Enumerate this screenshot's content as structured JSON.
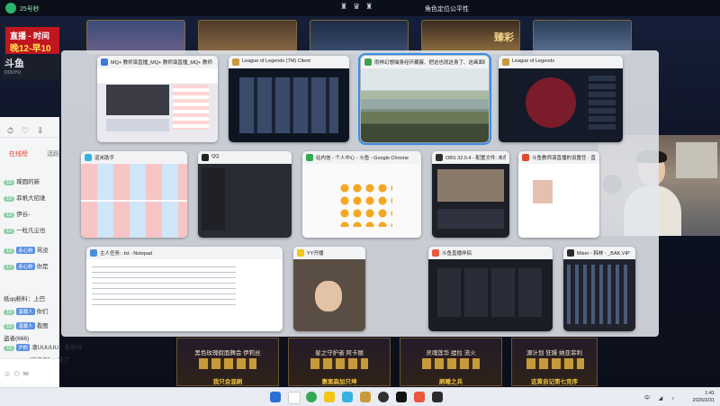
{
  "top_bar": {
    "app_name": "25号秒",
    "center_title": "角色定位公平性"
  },
  "stream": {
    "tag_line1": "直播 - 时间",
    "tag_line2": "晚12-早10",
    "logo_big": "斗鱼",
    "logo_small": "DOUYU",
    "hero_banner": "臻彩",
    "bottom_cards": [
      {
        "name": "黑色玫瑰假面舞会 伊莉丝",
        "sub": "我只会混刷"
      },
      {
        "name": "星之守护者 阿卡丽",
        "sub": "惠案森加只坤"
      },
      {
        "name": "灵魂莲华 缇拉 流火",
        "sub": "刷睡之兵"
      },
      {
        "name": "源计划 狂躁 纳亚菲利",
        "sub": "这黄自记第七竞序"
      }
    ]
  },
  "chat": {
    "tab_active": "在线榜",
    "tab_other": "活跃",
    "messages": [
      {
        "level": "15",
        "fan": "",
        "text": "璨圆的新"
      },
      {
        "level": "15",
        "fan": "",
        "text": "菲帆大招谁"
      },
      {
        "level": "13",
        "fan": "",
        "text": "伊谷-"
      },
      {
        "level": "12",
        "fan": "",
        "text": "一粒凡尘也"
      },
      {
        "level": "13",
        "fan": "赤心粉",
        "text": "骂没"
      },
      {
        "level": "17",
        "fan": "赤心粉",
        "text": "你是"
      },
      {
        "level": "",
        "fan": "",
        "text": "纸qq粉料：上巴"
      },
      {
        "level": "15",
        "fan": "温暖人",
        "text": "你们"
      },
      {
        "level": "15",
        "fan": "温暖人",
        "text": "看图"
      },
      {
        "level": "",
        "fan": "",
        "text": "盗者(666)"
      },
      {
        "level": "15",
        "fan": "沪粉",
        "text": "凛UUUUU：看剧呀"
      },
      {
        "level": "15",
        "fan": "CI5",
        "text": "[消息刷] ：来了"
      }
    ]
  },
  "switcher": {
    "windows": [
      {
        "title": "MQ+ 教师演直播_MQ+ 教师演直播_MQ+ 教师 教师演直播...",
        "icon_color": "#3a7bd5",
        "selected": false
      },
      {
        "title": "League of Legends (TM) Client",
        "icon_color": "#c89b3c",
        "selected": false
      },
      {
        "title": "雨林幻想描身经环藏蔽、把这也就这身了、这画面时...",
        "icon_color": "#3fa34d",
        "selected": true
      },
      {
        "title": "League of Legends",
        "icon_color": "#c89b3c",
        "selected": false
      },
      {
        "title": "道米助手",
        "icon_color": "#3ab0e0",
        "selected": false
      },
      {
        "title": "QQ",
        "icon_color": "#222222",
        "selected": false
      },
      {
        "title": "站内信 - 个人中心 - 斗鱼 - Google Chrome",
        "icon_color": "#34a853",
        "selected": false
      },
      {
        "title": "OBS 32.0.4 - 配置文件: 未命名...",
        "icon_color": "#303030",
        "selected": false
      },
      {
        "title": "斗鱼教师演直播的设置任 - 直帮 - 同伴",
        "icon_color": "#e04a2e",
        "selected": false
      },
      {
        "title": "主人任务: .txt - Notepad",
        "icon_color": "#4a90d9",
        "selected": false
      },
      {
        "title": "YY开播",
        "icon_color": "#f5c518",
        "selected": false
      },
      {
        "title": "斗鱼直播伴侣",
        "icon_color": "#e9573f",
        "selected": false
      },
      {
        "title": "Mixer - 韩林 - _BAK.VIP",
        "icon_color": "#2c2c2c",
        "selected": false
      }
    ]
  },
  "taskbar": {
    "time": "1:41",
    "date": "2026/3/31",
    "tray_text": "中"
  }
}
